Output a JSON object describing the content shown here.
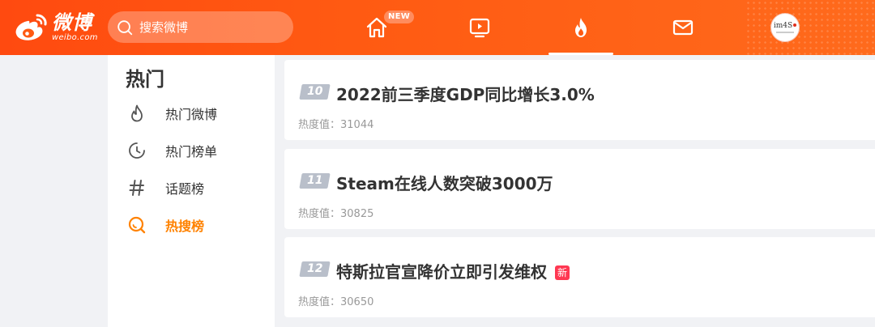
{
  "header": {
    "logo": {
      "cn": "微博",
      "en": "weibo.com"
    },
    "search": {
      "placeholder": "搜索微博"
    },
    "nav": [
      {
        "name": "home-icon",
        "badge": "NEW"
      },
      {
        "name": "video-icon"
      },
      {
        "name": "hot-icon",
        "active": true
      },
      {
        "name": "mail-icon"
      }
    ],
    "avatar": {
      "text": "im4S"
    },
    "colors": {
      "brand": "#ff5a12",
      "active_tab": "#ff8200"
    }
  },
  "sidebar": {
    "title": "热门",
    "items": [
      {
        "icon": "flame-icon",
        "label": "热门微博",
        "active": false
      },
      {
        "icon": "clock-icon",
        "label": "热门榜单",
        "active": false
      },
      {
        "icon": "hashtag-icon",
        "label": "话题榜",
        "active": false
      },
      {
        "icon": "search-hot-icon",
        "label": "热搜榜",
        "active": true
      }
    ]
  },
  "cards": [
    {
      "rank": "10",
      "title": "2022前三季度GDP同比增长3.0%",
      "heat_label": "热度值：",
      "heat_value": "31044",
      "badge": ""
    },
    {
      "rank": "11",
      "title": "Steam在线人数突破3000万",
      "heat_label": "热度值：",
      "heat_value": "30825",
      "badge": ""
    },
    {
      "rank": "12",
      "title": "特斯拉官宣降价立即引发维权",
      "heat_label": "热度值：",
      "heat_value": "30650",
      "badge": "新"
    }
  ]
}
